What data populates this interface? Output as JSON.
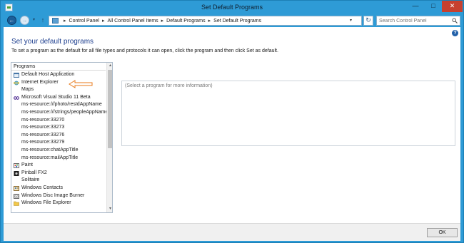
{
  "window": {
    "title": "Set Default Programs",
    "buttons": {
      "minimize": "—",
      "maximize": "□",
      "close": "✕"
    }
  },
  "nav": {
    "back": "←",
    "forward": "→",
    "dropdown": "▾",
    "up": "↑",
    "breadcrumbs": [
      "Control Panel",
      "All Control Panel Items",
      "Default Programs",
      "Set Default Programs"
    ],
    "breadcrumb_separator": "▸",
    "address_dropdown": "▾",
    "refresh": "↻",
    "search_placeholder": "Search Control Panel"
  },
  "page": {
    "help": "?",
    "heading": "Set your default programs",
    "description": "To set a program as the default for all file types and protocols it can open, click the program and then click Set as default."
  },
  "programs": {
    "header": "Programs",
    "items": [
      {
        "label": "Default Host Application",
        "icon": "app-window-icon"
      },
      {
        "label": "Internet Explorer",
        "icon": "internet-explorer-icon"
      },
      {
        "label": "Maps",
        "icon": ""
      },
      {
        "label": "Microsoft Visual Studio 11 Beta",
        "icon": "visual-studio-icon"
      },
      {
        "label": "ms-resource:///photo/resIdAppName",
        "icon": ""
      },
      {
        "label": "ms-resource:///strings/peopleAppName",
        "icon": ""
      },
      {
        "label": "ms-resource:33270",
        "icon": ""
      },
      {
        "label": "ms-resource:33273",
        "icon": ""
      },
      {
        "label": "ms-resource:33276",
        "icon": ""
      },
      {
        "label": "ms-resource:33279",
        "icon": ""
      },
      {
        "label": "ms-resource:chatAppTitle",
        "icon": ""
      },
      {
        "label": "ms-resource:mailAppTitle",
        "icon": ""
      },
      {
        "label": "Paint",
        "icon": "paint-icon"
      },
      {
        "label": "Pinball FX2",
        "icon": "pinball-icon"
      },
      {
        "label": "Solitaire",
        "icon": ""
      },
      {
        "label": "Windows Contacts",
        "icon": "contacts-icon"
      },
      {
        "label": "Windows Disc Image Burner",
        "icon": "disc-burner-icon"
      },
      {
        "label": "Windows File Explorer",
        "icon": "folder-icon"
      }
    ],
    "scroll_up": "▴",
    "scroll_down": "▾"
  },
  "info_panel": {
    "placeholder": "(Select a program for more information)"
  },
  "footer": {
    "ok_label": "OK"
  },
  "colors": {
    "frame": "#2e9bd6",
    "heading": "#1e3f8f",
    "close": "#c7402f",
    "annotation_arrow": "#e87a1a"
  }
}
